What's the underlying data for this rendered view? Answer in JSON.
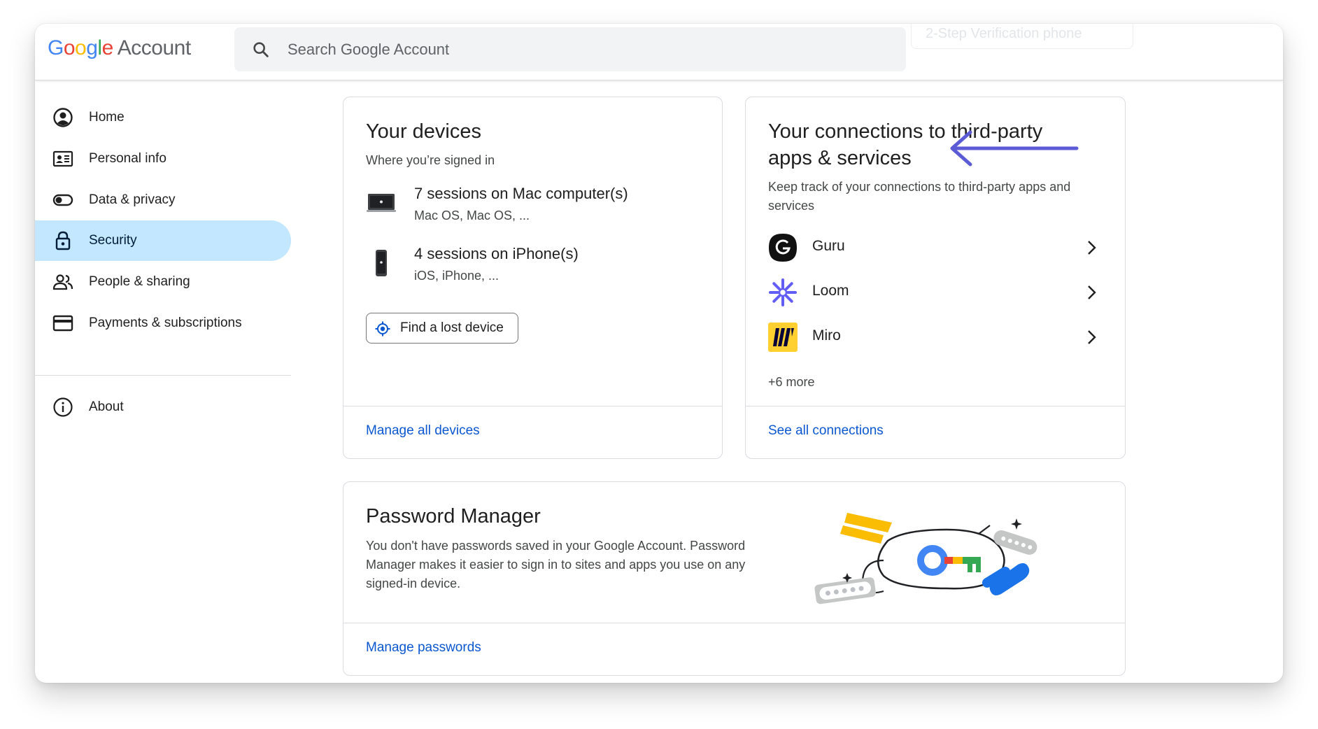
{
  "header": {
    "logo_google": [
      "G",
      "o",
      "o",
      "g",
      "l",
      "e"
    ],
    "logo_account": "Account",
    "search_placeholder": "Search Google Account",
    "ghost_chip": "2-Step Verification phone"
  },
  "sidebar": {
    "items": [
      {
        "label": "Home",
        "icon": "account-circle-icon",
        "active": false
      },
      {
        "label": "Personal info",
        "icon": "id-card-icon",
        "active": false
      },
      {
        "label": "Data & privacy",
        "icon": "toggle-icon",
        "active": false
      },
      {
        "label": "Security",
        "icon": "lock-icon",
        "active": true
      },
      {
        "label": "People & sharing",
        "icon": "people-icon",
        "active": false
      },
      {
        "label": "Payments & subscriptions",
        "icon": "credit-card-icon",
        "active": false
      },
      {
        "label": "About",
        "icon": "info-icon",
        "active": false
      }
    ]
  },
  "devices_card": {
    "title": "Your devices",
    "subtitle": "Where you’re signed in",
    "devices": [
      {
        "title": "7 sessions on Mac computer(s)",
        "detail": "Mac OS, Mac OS, ...",
        "icon": "laptop-icon"
      },
      {
        "title": "4 sessions on iPhone(s)",
        "detail": "iOS, iPhone, ...",
        "icon": "phone-icon"
      }
    ],
    "find_button": "Find a lost device",
    "footer_link": "Manage all devices"
  },
  "connections_card": {
    "title_line1": "Your connections to third-party",
    "title_line2": "apps & services",
    "subtitle_line1": "Keep track of your connections to third-party apps and",
    "subtitle_line2": "services",
    "apps": [
      {
        "name": "Guru",
        "icon": "guru-logo"
      },
      {
        "name": "Loom",
        "icon": "loom-logo"
      },
      {
        "name": "Miro",
        "icon": "miro-logo"
      }
    ],
    "more": "+6 more",
    "footer_link": "See all connections"
  },
  "password_card": {
    "title": "Password Manager",
    "desc_line1": "You don't have passwords saved in your Google Account. Password",
    "desc_line2": "Manager makes it easier to sign in to sites and apps you use on any",
    "desc_line3": "signed-in device.",
    "footer_link": "Manage passwords"
  },
  "colors": {
    "active_nav": "#c2e7ff",
    "link": "#0b57d0",
    "annotation_arrow": "#5b5bd6"
  }
}
